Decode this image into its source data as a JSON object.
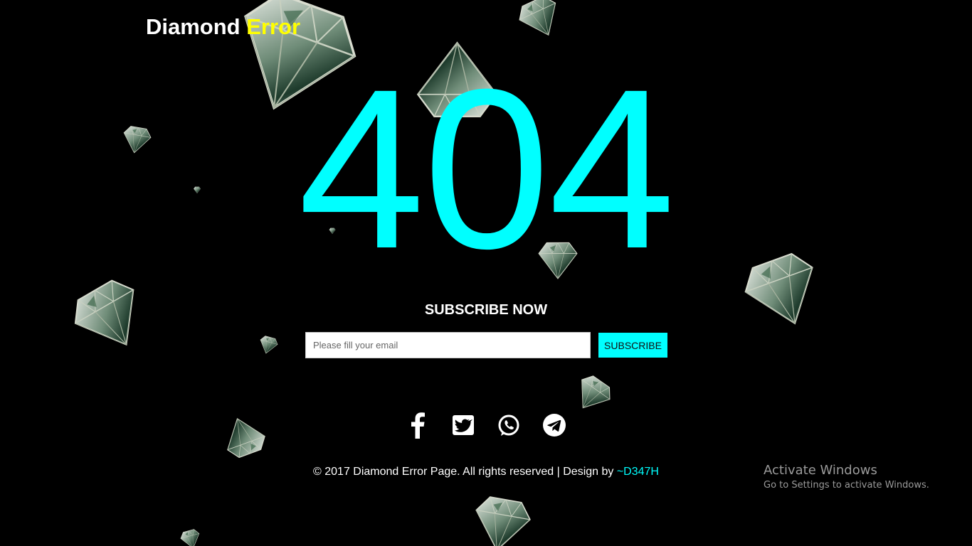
{
  "brand": {
    "part1": "Diamond ",
    "part2": "Error"
  },
  "error_code": "404",
  "subscribe": {
    "title": "SUBSCRIBE NOW",
    "email_placeholder": "Please fill your email",
    "button_label": "SUBSCRIBE"
  },
  "social": [
    {
      "name": "facebook",
      "icon": "facebook-icon"
    },
    {
      "name": "twitter",
      "icon": "twitter-icon"
    },
    {
      "name": "whatsapp",
      "icon": "whatsapp-icon"
    },
    {
      "name": "telegram",
      "icon": "telegram-icon"
    }
  ],
  "footer": {
    "text": "© 2017 Diamond Error Page. All rights reserved | Design by ",
    "designer": "~D347H"
  },
  "watermark": {
    "line1": "Activate Windows",
    "line2": "Go to Settings to activate Windows."
  },
  "colors": {
    "accent": "#00ffff",
    "brand_accent": "#ffff00",
    "background": "#000000"
  }
}
